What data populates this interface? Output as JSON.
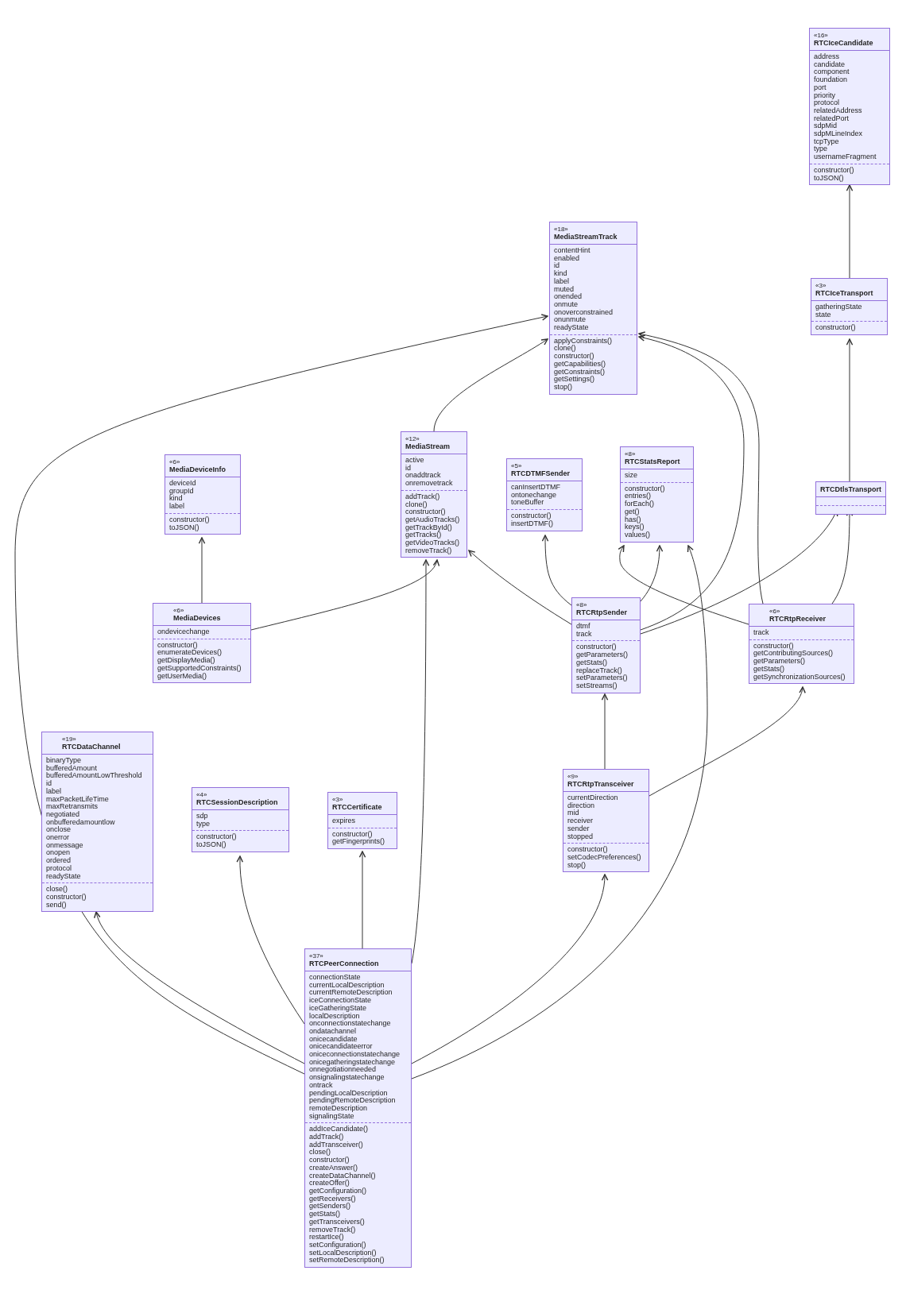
{
  "diagram": {
    "classes": [
      {
        "stereotype": "«16»",
        "name": "RTCIceCandidate",
        "attributes": [
          "address",
          "candidate",
          "component",
          "foundation",
          "port",
          "priority",
          "protocol",
          "relatedAddress",
          "relatedPort",
          "sdpMid",
          "sdpMLineIndex",
          "tcpType",
          "type",
          "usernameFragment"
        ],
        "methods": [
          "constructor()",
          "toJSON()"
        ]
      },
      {
        "stereotype": "«18»",
        "name": "MediaStreamTrack",
        "attributes": [
          "contentHint",
          "enabled",
          "id",
          "kind",
          "label",
          "muted",
          "onended",
          "onmute",
          "onoverconstrained",
          "onunmute",
          "readyState"
        ],
        "methods": [
          "applyConstraints()",
          "clone()",
          "constructor()",
          "getCapabilities()",
          "getConstraints()",
          "getSettings()",
          "stop()"
        ]
      },
      {
        "stereotype": "«3»",
        "name": "RTCIceTransport",
        "attributes": [
          "gatheringState",
          "state"
        ],
        "methods": [
          "constructor()"
        ]
      },
      {
        "stereotype": "«6»",
        "name": "MediaDeviceInfo",
        "attributes": [
          "deviceId",
          "groupId",
          "kind",
          "label"
        ],
        "methods": [
          "constructor()",
          "toJSON()"
        ]
      },
      {
        "stereotype": "«12»",
        "name": "MediaStream",
        "attributes": [
          "active",
          "id",
          "onaddtrack",
          "onremovetrack"
        ],
        "methods": [
          "addTrack()",
          "clone()",
          "constructor()",
          "getAudioTracks()",
          "getTrackById()",
          "getTracks()",
          "getVideoTracks()",
          "removeTrack()"
        ]
      },
      {
        "stereotype": "«5»",
        "name": "RTCDTMFSender",
        "attributes": [
          "canInsertDTMF",
          "ontonechange",
          "toneBuffer"
        ],
        "methods": [
          "constructor()",
          "insertDTMF()"
        ]
      },
      {
        "stereotype": "«8»",
        "name": "RTCStatsReport",
        "attributes": [
          "size"
        ],
        "methods": [
          "constructor()",
          "entries()",
          "forEach()",
          "get()",
          "has()",
          "keys()",
          "values()"
        ]
      },
      {
        "name": "RTCDtlsTransport"
      },
      {
        "stereotype": "«6»",
        "name": "MediaDevices",
        "attributes": [
          "ondevicechange"
        ],
        "methods": [
          "constructor()",
          "enumerateDevices()",
          "getDisplayMedia()",
          "getSupportedConstraints()",
          "getUserMedia()"
        ]
      },
      {
        "stereotype": "«8»",
        "name": "RTCRtpSender",
        "attributes": [
          "dtmf",
          "track"
        ],
        "methods": [
          "constructor()",
          "getParameters()",
          "getStats()",
          "replaceTrack()",
          "setParameters()",
          "setStreams()"
        ]
      },
      {
        "stereotype": "«6»",
        "name": "RTCRtpReceiver",
        "attributes": [
          "track"
        ],
        "methods": [
          "constructor()",
          "getContributingSources()",
          "getParameters()",
          "getStats()",
          "getSynchronizationSources()"
        ]
      },
      {
        "stereotype": "«19»",
        "name": "RTCDataChannel",
        "attributes": [
          "binaryType",
          "bufferedAmount",
          "bufferedAmountLowThreshold",
          "id",
          "label",
          "maxPacketLifeTime",
          "maxRetransmits",
          "negotiated",
          "onbufferedamountlow",
          "onclose",
          "onerror",
          "onmessage",
          "onopen",
          "ordered",
          "protocol",
          "readyState"
        ],
        "methods": [
          "close()",
          "constructor()",
          "send()"
        ]
      },
      {
        "stereotype": "«4»",
        "name": "RTCSessionDescription",
        "attributes": [
          "sdp",
          "type"
        ],
        "methods": [
          "constructor()",
          "toJSON()"
        ]
      },
      {
        "stereotype": "«3»",
        "name": "RTCCertificate",
        "attributes": [
          "expires"
        ],
        "methods": [
          "constructor()",
          "getFingerprints()"
        ]
      },
      {
        "stereotype": "«9»",
        "name": "RTCRtpTransceiver",
        "attributes": [
          "currentDirection",
          "direction",
          "mid",
          "receiver",
          "sender",
          "stopped"
        ],
        "methods": [
          "constructor()",
          "setCodecPreferences()",
          "stop()"
        ]
      },
      {
        "stereotype": "«37»",
        "name": "RTCPeerConnection",
        "attributes": [
          "connectionState",
          "currentLocalDescription",
          "currentRemoteDescription",
          "iceConnectionState",
          "iceGatheringState",
          "localDescription",
          "onconnectionstatechange",
          "ondatachannel",
          "onicecandidate",
          "onicecandidateerror",
          "oniceconnectionstatechange",
          "onicegatheringstatechange",
          "onnegotiationneeded",
          "onsignalingstatechange",
          "ontrack",
          "pendingLocalDescription",
          "pendingRemoteDescription",
          "remoteDescription",
          "signalingState"
        ],
        "methods": [
          "addIceCandidate()",
          "addTrack()",
          "addTransceiver()",
          "close()",
          "constructor()",
          "createAnswer()",
          "createDataChannel()",
          "createOffer()",
          "getConfiguration()",
          "getReceivers()",
          "getSenders()",
          "getStats()",
          "getTransceivers()",
          "removeTrack()",
          "restartIce()",
          "setConfiguration()",
          "setLocalDescription()",
          "setRemoteDescription()"
        ]
      }
    ]
  }
}
